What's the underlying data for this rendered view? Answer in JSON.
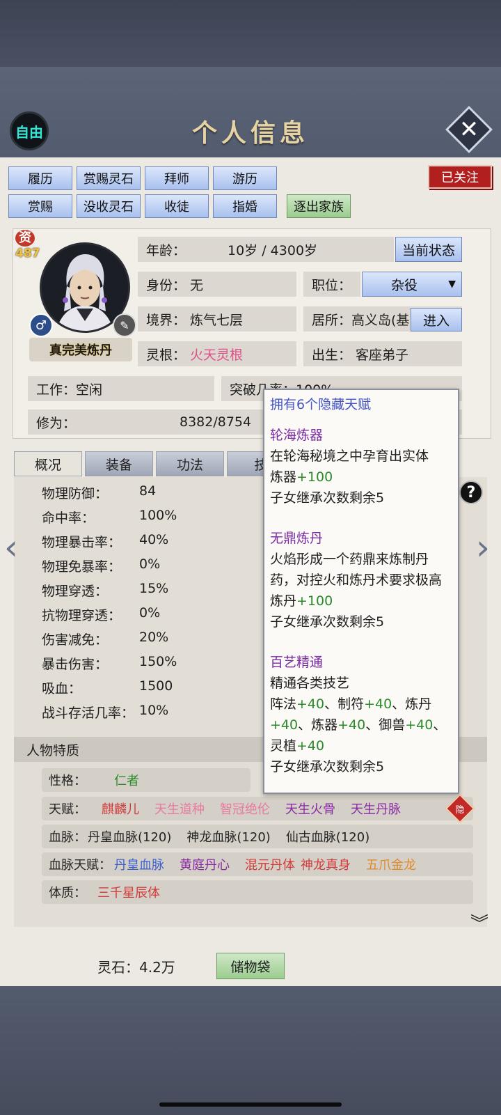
{
  "header": {
    "mode_badge": "自由",
    "title": "个人信息",
    "close_symbol": "✕"
  },
  "actions": {
    "row1": [
      "履历",
      "赏赐灵石",
      "拜师",
      "游历"
    ],
    "row2": [
      "赏赐",
      "没收灵石",
      "收徒",
      "指婚",
      "逐出家族"
    ],
    "follow": "已关注"
  },
  "profile": {
    "aptitude_label": "资",
    "aptitude_value": "487",
    "gender_symbol": "♂",
    "title_plate": "真完美炼丹",
    "age_label": "年龄：",
    "age_value": "10岁 / 4300岁",
    "status_button": "当前状态",
    "identity": "身份： 无",
    "position_label": "职位：",
    "position_value": "杂役",
    "realm": "境界： 炼气七层",
    "residence": "居所：高义岛(基",
    "enter_button": "进入",
    "root_label": "灵根：",
    "root_value": "火天灵根",
    "origin": "出生： 客座弟子",
    "work": "工作：空闲",
    "breakthrough": "突破几率：100%",
    "cultivation_label": "修为：",
    "cultivation_value": "8382/8754"
  },
  "tabs": [
    "概况",
    "装备",
    "功法",
    "技"
  ],
  "stats": [
    {
      "label": "物理防御：",
      "value": "84"
    },
    {
      "label": "命中率：",
      "value": "100%"
    },
    {
      "label": "物理暴击率：",
      "value": "40%"
    },
    {
      "label": "物理免暴率：",
      "value": "0%"
    },
    {
      "label": "物理穿透：",
      "value": "15%"
    },
    {
      "label": "抗物理穿透：",
      "value": "0%"
    },
    {
      "label": "伤害减免：",
      "value": "20%"
    },
    {
      "label": "暴击伤害：",
      "value": "150%"
    },
    {
      "label": "吸血：",
      "value": "1500"
    },
    {
      "label": "战斗存活几率：",
      "value": "10%"
    }
  ],
  "traits": {
    "header": "人物特质",
    "personality_label": "性格：",
    "personality_value": "仁者",
    "talent_label": "天赋：",
    "talents": [
      "麒麟儿",
      "天生道种",
      "智冠绝伦",
      "天生火骨",
      "天生丹脉"
    ],
    "hidden_tag": "隐",
    "bloodline_label": "血脉：",
    "bloodlines": [
      "丹皇血脉(120)",
      "神龙血脉(120)",
      "仙古血脉(120)"
    ],
    "bloodline_talent_label": "血脉天赋：",
    "bloodline_talents": [
      "丹皇血脉",
      "黄庭丹心",
      "混元丹体",
      "神龙真身",
      "五爪金龙"
    ],
    "physique_label": "体质：",
    "physique_value": "三千星辰体"
  },
  "tooltip": {
    "header": "拥有6个隐藏天赋",
    "t1_name": "轮海炼器",
    "t1_desc": "在轮海秘境之中孕育出实体",
    "t1_effect": "炼器",
    "t1_plus": "+100",
    "t1_inherit": "子女继承次数剩余5",
    "t2_name": "无鼎炼丹",
    "t2_desc": "火焰形成一个药鼎来炼制丹药，对控火和炼丹术要求极高",
    "t2_effect": "炼丹",
    "t2_plus": "+100",
    "t2_inherit": "子女继承次数剩余5",
    "t3_name": "百艺精通",
    "t3_desc": "精通各类技艺",
    "t3_e1": "阵法",
    "t3_p1": "+40",
    "t3_e2": "、制符",
    "t3_p2": "+40",
    "t3_e3": "、炼丹",
    "t3_p3": "+40",
    "t3_e4": "、炼器",
    "t3_p4": "+40",
    "t3_e5": "、御兽",
    "t3_p5": "+40",
    "t3_e6": "、灵植",
    "t3_p6": "+40",
    "t3_inherit": "子女继承次数剩余5"
  },
  "footer": {
    "spirit_stones": "灵石：4.2万",
    "storage": "储物袋"
  }
}
